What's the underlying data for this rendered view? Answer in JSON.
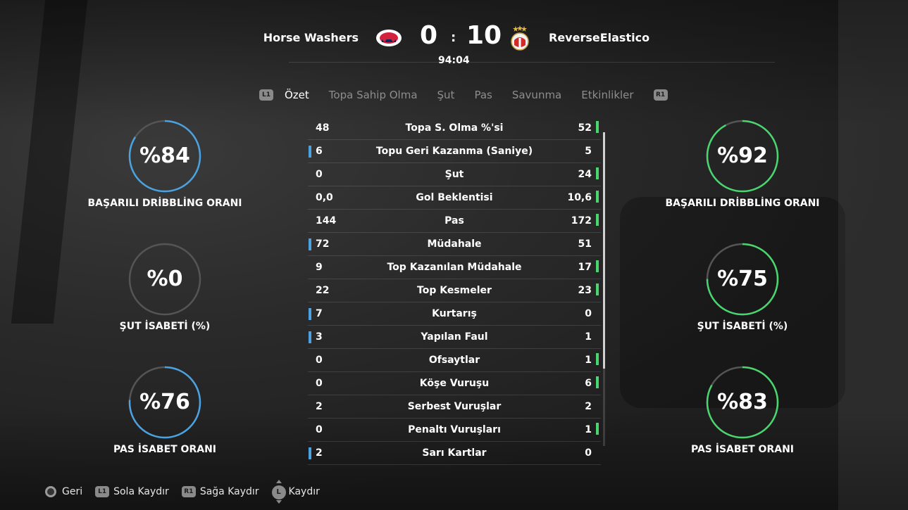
{
  "header": {
    "home_team": "Horse Washers",
    "away_team": "ReverseElastico",
    "home_score": "0",
    "separator": ":",
    "away_score": "10",
    "time": "94:04"
  },
  "tabs": {
    "left_button": "L1",
    "right_button": "R1",
    "items": [
      {
        "label": "Özet",
        "active": true
      },
      {
        "label": "Topa Sahip Olma",
        "active": false
      },
      {
        "label": "Şut",
        "active": false
      },
      {
        "label": "Pas",
        "active": false
      },
      {
        "label": "Savunma",
        "active": false
      },
      {
        "label": "Etkinlikler",
        "active": false
      }
    ]
  },
  "home_gauges": [
    {
      "value": "%84",
      "label": "BAŞARILI DRİBBLİNG ORANI",
      "percent": 84
    },
    {
      "value": "%0",
      "label": "ŞUT İSABETİ (%)",
      "percent": 0
    },
    {
      "value": "%76",
      "label": "PAS İSABET ORANI",
      "percent": 76
    }
  ],
  "away_gauges": [
    {
      "value": "%92",
      "label": "BAŞARILI DRİBBLİNG ORANI",
      "percent": 92
    },
    {
      "value": "%75",
      "label": "ŞUT İSABETİ (%)",
      "percent": 75
    },
    {
      "value": "%83",
      "label": "PAS İSABET ORANI",
      "percent": 83
    }
  ],
  "stats": [
    {
      "name": "Topa S. Olma %'si",
      "home": "48",
      "away": "52",
      "leader": "away"
    },
    {
      "name": "Topu Geri Kazanma (Saniye)",
      "home": "6",
      "away": "5",
      "leader": "home"
    },
    {
      "name": "Şut",
      "home": "0",
      "away": "24",
      "leader": "away"
    },
    {
      "name": "Gol Beklentisi",
      "home": "0,0",
      "away": "10,6",
      "leader": "away"
    },
    {
      "name": "Pas",
      "home": "144",
      "away": "172",
      "leader": "away"
    },
    {
      "name": "Müdahale",
      "home": "72",
      "away": "51",
      "leader": "home"
    },
    {
      "name": "Top Kazanılan Müdahale",
      "home": "9",
      "away": "17",
      "leader": "away"
    },
    {
      "name": "Top Kesmeler",
      "home": "22",
      "away": "23",
      "leader": "away"
    },
    {
      "name": "Kurtarış",
      "home": "7",
      "away": "0",
      "leader": "home"
    },
    {
      "name": "Yapılan Faul",
      "home": "3",
      "away": "1",
      "leader": "home"
    },
    {
      "name": "Ofsaytlar",
      "home": "0",
      "away": "1",
      "leader": "away"
    },
    {
      "name": "Köşe Vuruşu",
      "home": "0",
      "away": "6",
      "leader": "away"
    },
    {
      "name": "Serbest Vuruşlar",
      "home": "2",
      "away": "2",
      "leader": "none"
    },
    {
      "name": "Penaltı Vuruşları",
      "home": "0",
      "away": "1",
      "leader": "away"
    },
    {
      "name": "Sarı Kartlar",
      "home": "2",
      "away": "0",
      "leader": "home"
    }
  ],
  "footer": {
    "back_label": "Geri",
    "l1_button": "L1",
    "l1_label": "Sola Kaydır",
    "r1_button": "R1",
    "r1_label": "Sağa Kaydır",
    "stick_button": "L",
    "stick_label": "Kaydır"
  },
  "colors": {
    "home_accent": "#4aa3e0",
    "away_accent": "#49d66f",
    "gauge_track": "#555555"
  }
}
